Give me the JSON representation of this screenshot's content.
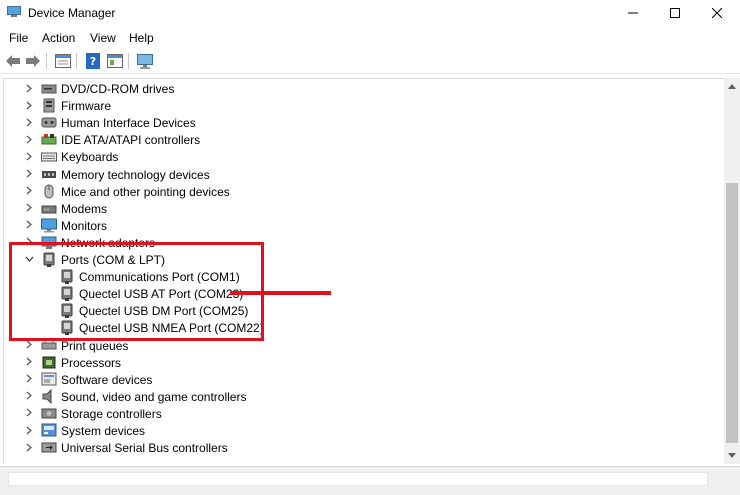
{
  "window": {
    "title": "Device Manager"
  },
  "menu": {
    "items": [
      "File",
      "Action",
      "View",
      "Help"
    ]
  },
  "toolbar": {
    "buttons": [
      "back-icon",
      "forward-icon",
      "properties-icon",
      "help-icon",
      "show-hidden-icon",
      "monitor-scan-icon"
    ]
  },
  "tree": {
    "categories": [
      {
        "label": "DVD/CD-ROM drives",
        "icon": "dvd-drive-icon",
        "expanded": false
      },
      {
        "label": "Firmware",
        "icon": "firmware-icon",
        "expanded": false
      },
      {
        "label": "Human Interface Devices",
        "icon": "hid-icon",
        "expanded": false
      },
      {
        "label": "IDE ATA/ATAPI controllers",
        "icon": "ide-controller-icon",
        "expanded": false
      },
      {
        "label": "Keyboards",
        "icon": "keyboard-icon",
        "expanded": false
      },
      {
        "label": "Memory technology devices",
        "icon": "memory-icon",
        "expanded": false
      },
      {
        "label": "Mice and other pointing devices",
        "icon": "mouse-icon",
        "expanded": false
      },
      {
        "label": "Modems",
        "icon": "modem-icon",
        "expanded": false
      },
      {
        "label": "Monitors",
        "icon": "monitor-icon",
        "expanded": false
      },
      {
        "label": "Network adapters",
        "icon": "network-adapter-icon",
        "expanded": false
      },
      {
        "label": "Ports (COM & LPT)",
        "icon": "port-icon",
        "expanded": true
      },
      {
        "label": "Print queues",
        "icon": "printer-icon",
        "expanded": false
      },
      {
        "label": "Processors",
        "icon": "processor-icon",
        "expanded": false
      },
      {
        "label": "Software devices",
        "icon": "software-device-icon",
        "expanded": false
      },
      {
        "label": "Sound, video and game controllers",
        "icon": "sound-icon",
        "expanded": false
      },
      {
        "label": "Storage controllers",
        "icon": "storage-controller-icon",
        "expanded": false
      },
      {
        "label": "System devices",
        "icon": "system-device-icon",
        "expanded": false
      },
      {
        "label": "Universal Serial Bus controllers",
        "icon": "usb-icon",
        "expanded": false
      }
    ],
    "ports_children": [
      {
        "label": "Communications Port (COM1)",
        "icon": "port-icon"
      },
      {
        "label": "Quectel USB AT Port (COM23)",
        "icon": "port-icon"
      },
      {
        "label": "Quectel USB DM Port (COM25)",
        "icon": "port-icon"
      },
      {
        "label": "Quectel USB NMEA Port (COM22)",
        "icon": "port-icon"
      }
    ]
  },
  "colors": {
    "annotation": "#e0101e",
    "scrollbar_thumb": "#c2c2c2"
  }
}
